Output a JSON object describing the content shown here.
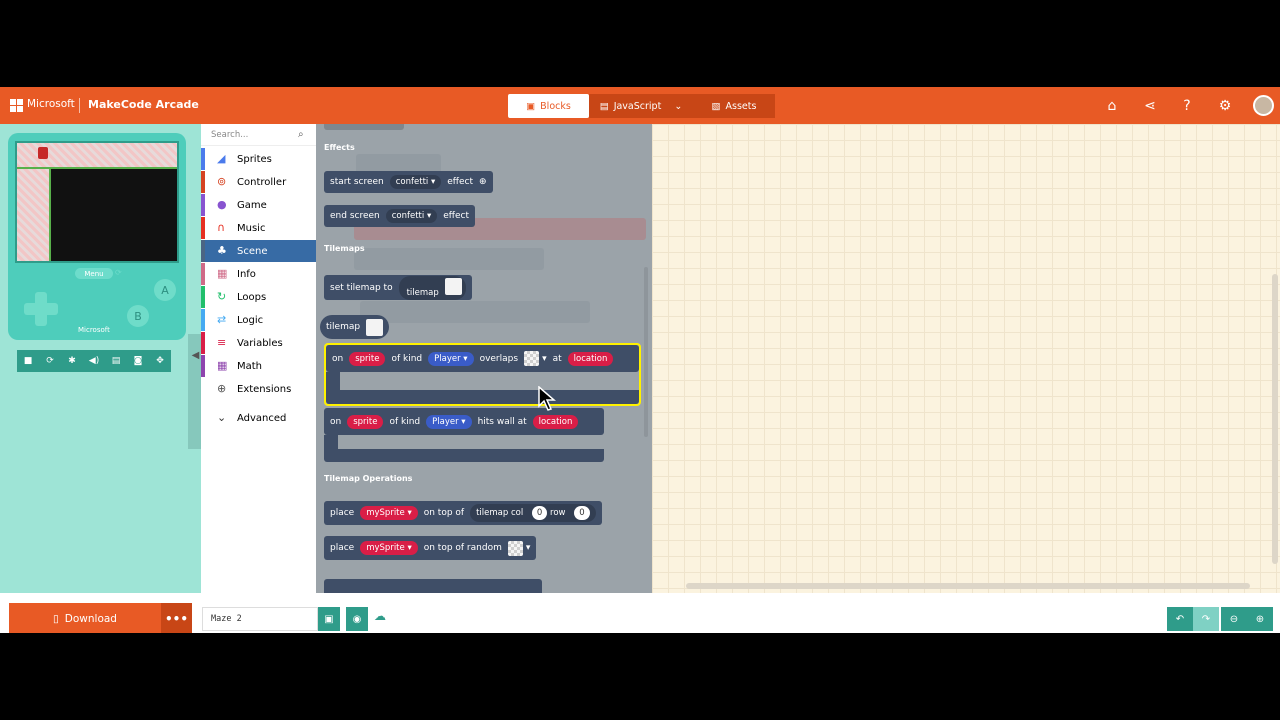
{
  "header": {
    "brand_ms": "Microsoft",
    "brand_app": "MakeCode Arcade",
    "tabs": [
      {
        "label": "Blocks",
        "icon": "puzzle-icon"
      },
      {
        "label": "JavaScript",
        "icon": "code-icon"
      },
      {
        "label": "Assets",
        "icon": "assets-icon"
      }
    ],
    "accent": "#e85a25"
  },
  "simulator": {
    "menu": "Menu",
    "a": "A",
    "b": "B",
    "ms": "Microsoft"
  },
  "toolbox": {
    "search_placeholder": "Search...",
    "categories": [
      {
        "label": "Sprites",
        "color": "#4b7bec"
      },
      {
        "label": "Controller",
        "color": "#d54322"
      },
      {
        "label": "Game",
        "color": "#8854d0"
      },
      {
        "label": "Music",
        "color": "#e63022"
      },
      {
        "label": "Scene",
        "color": "#4b6584"
      },
      {
        "label": "Info",
        "color": "#cf6a87"
      },
      {
        "label": "Loops",
        "color": "#20bf6b"
      },
      {
        "label": "Logic",
        "color": "#45aaf2"
      },
      {
        "label": "Variables",
        "color": "#d91e47"
      },
      {
        "label": "Math",
        "color": "#8e44ad"
      },
      {
        "label": "Extensions",
        "color": "#555555"
      },
      {
        "label": "Advanced",
        "color": "#333333"
      }
    ]
  },
  "flyout": {
    "sections": {
      "effects": "Effects",
      "tilemaps": "Tilemaps",
      "tilemap_ops": "Tilemap Operations"
    },
    "blocks": {
      "start_screen": {
        "t1": "start screen",
        "d1": "confetti",
        "t2": "effect"
      },
      "end_screen": {
        "t1": "end screen",
        "d1": "confetti",
        "t2": "effect"
      },
      "set_tilemap": {
        "t1": "set tilemap to",
        "t2": "tilemap"
      },
      "tilemap": {
        "t1": "tilemap"
      },
      "overlaps": {
        "on": "on",
        "sprite": "sprite",
        "ofkind": "of kind",
        "kind": "Player",
        "overlaps": "overlaps",
        "at": "at",
        "location": "location"
      },
      "hitswall": {
        "on": "on",
        "sprite": "sprite",
        "ofkind": "of kind",
        "kind": "Player",
        "hits": "hits wall at",
        "location": "location"
      },
      "place1": {
        "place": "place",
        "sprite": "mySprite",
        "ontop": "on top of",
        "tm": "tilemap col",
        "col": "0",
        "row": "row",
        "rowv": "0"
      },
      "place2": {
        "place": "place",
        "sprite": "mySprite",
        "ontop": "on top of random"
      }
    }
  },
  "footer": {
    "download": "Download",
    "more": "•••",
    "project_name": "Maze 2"
  }
}
